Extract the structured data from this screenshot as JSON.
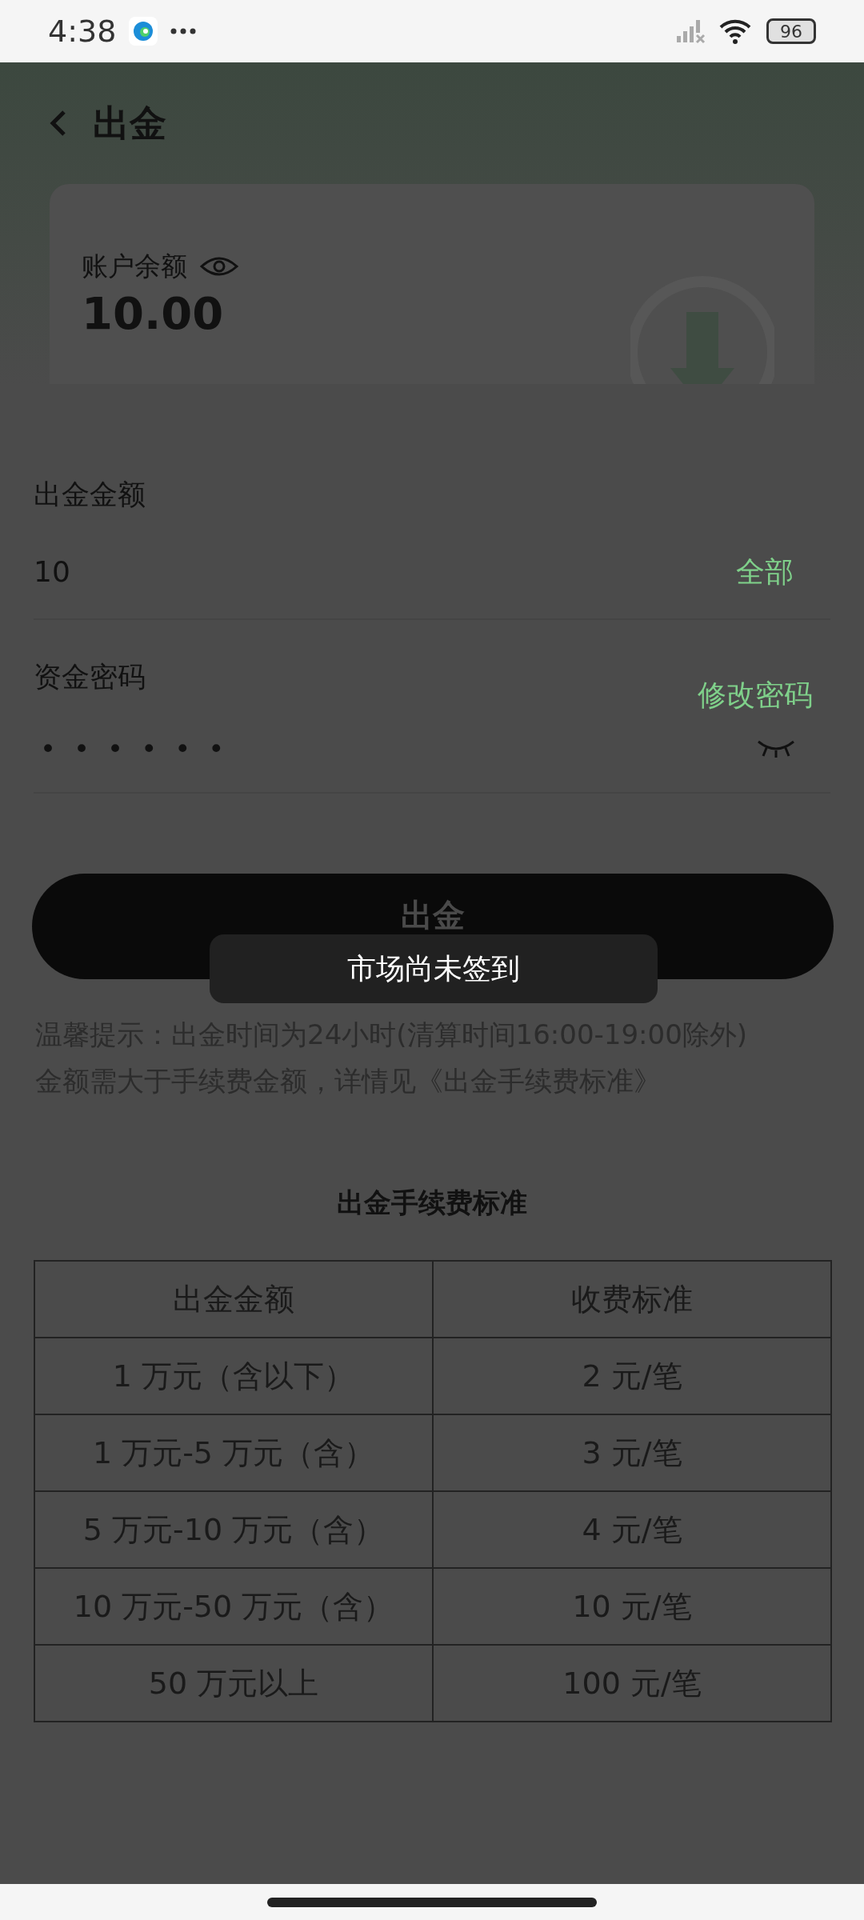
{
  "status_bar": {
    "time": "4:38",
    "battery": "96"
  },
  "header": {
    "title": "出金"
  },
  "balance_card": {
    "label": "账户余额",
    "amount": "10.00"
  },
  "amount_field": {
    "label": "出金金额",
    "value": "10",
    "action": "全部"
  },
  "password_field": {
    "label": "资金密码",
    "action": "修改密码",
    "masked_value": "••••••"
  },
  "submit_button": {
    "label": "出金"
  },
  "toast": {
    "text": "市场尚未签到"
  },
  "notice": [
    "温馨提示：出金时间为24小时(清算时间16:00-19:00除外)",
    "金额需大于手续费金额，详情见《出金手续费标准》"
  ],
  "fee_table": {
    "title": "出金手续费标准",
    "columns": [
      "出金金额",
      "收费标准"
    ],
    "rows": [
      [
        "1 万元（含以下）",
        "2 元/笔"
      ],
      [
        "1 万元-5 万元（含）",
        "3 元/笔"
      ],
      [
        "5 万元-10 万元（含）",
        "4 元/笔"
      ],
      [
        "10 万元-50 万元（含）",
        "10 元/笔"
      ],
      [
        "50 万元以上",
        "100 元/笔"
      ]
    ]
  }
}
